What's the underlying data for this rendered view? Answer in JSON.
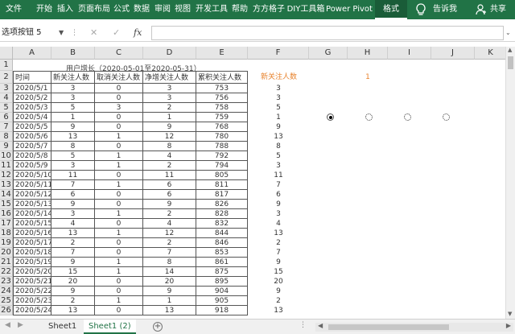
{
  "ribbon": {
    "tabs": [
      "文件",
      "开始",
      "插入",
      "页面布局",
      "公式",
      "数据",
      "审阅",
      "视图",
      "开发工具",
      "帮助",
      "方方格子",
      "DIY工具箱",
      "Power Pivot",
      "格式"
    ],
    "tell_me": "告诉我",
    "share": "共享"
  },
  "formula_bar": {
    "name_box": "选项按钮 5"
  },
  "columns": [
    "A",
    "B",
    "C",
    "D",
    "E",
    "F",
    "G",
    "H",
    "I",
    "J",
    "K"
  ],
  "row_numbers": [
    "1",
    "2",
    "3",
    "4",
    "5",
    "6",
    "7",
    "8",
    "9",
    "10",
    "11",
    "12",
    "13",
    "14",
    "15",
    "16",
    "17",
    "18",
    "19",
    "20",
    "21",
    "22",
    "23",
    "24",
    "25",
    "26"
  ],
  "table_title": "用户增长（2020-05-01至2020-05-31）",
  "table_headers": [
    "时间",
    "新关注人数",
    "取消关注人数",
    "净增关注人数",
    "累积关注人数"
  ],
  "table_rows": [
    [
      "2020/5/1",
      "3",
      "0",
      "3",
      "753"
    ],
    [
      "2020/5/2",
      "3",
      "0",
      "3",
      "756"
    ],
    [
      "2020/5/3",
      "5",
      "3",
      "2",
      "758"
    ],
    [
      "2020/5/4",
      "1",
      "0",
      "1",
      "759"
    ],
    [
      "2020/5/5",
      "9",
      "0",
      "9",
      "768"
    ],
    [
      "2020/5/6",
      "13",
      "1",
      "12",
      "780"
    ],
    [
      "2020/5/7",
      "8",
      "0",
      "8",
      "788"
    ],
    [
      "2020/5/8",
      "5",
      "1",
      "4",
      "792"
    ],
    [
      "2020/5/9",
      "3",
      "1",
      "2",
      "794"
    ],
    [
      "2020/5/10",
      "11",
      "0",
      "11",
      "805"
    ],
    [
      "2020/5/11",
      "7",
      "1",
      "6",
      "811"
    ],
    [
      "2020/5/12",
      "6",
      "0",
      "6",
      "817"
    ],
    [
      "2020/5/13",
      "9",
      "0",
      "9",
      "826"
    ],
    [
      "2020/5/14",
      "3",
      "1",
      "2",
      "828"
    ],
    [
      "2020/5/15",
      "4",
      "0",
      "4",
      "832"
    ],
    [
      "2020/5/16",
      "13",
      "1",
      "12",
      "844"
    ],
    [
      "2020/5/17",
      "2",
      "0",
      "2",
      "846"
    ],
    [
      "2020/5/18",
      "7",
      "0",
      "7",
      "853"
    ],
    [
      "2020/5/19",
      "9",
      "1",
      "8",
      "861"
    ],
    [
      "2020/5/20",
      "15",
      "1",
      "14",
      "875"
    ],
    [
      "2020/5/21",
      "20",
      "0",
      "20",
      "895"
    ],
    [
      "2020/5/22",
      "9",
      "0",
      "9",
      "904"
    ],
    [
      "2020/5/23",
      "2",
      "1",
      "1",
      "905"
    ],
    [
      "2020/5/24",
      "13",
      "0",
      "13",
      "918"
    ]
  ],
  "helper_label": "新关注人数",
  "helper_value": "1",
  "helper_column": [
    "3",
    "3",
    "5",
    "1",
    "9",
    "13",
    "8",
    "5",
    "3",
    "11",
    "7",
    "6",
    "9",
    "3",
    "4",
    "13",
    "2",
    "7",
    "9",
    "15",
    "20",
    "9",
    "2",
    "13"
  ],
  "option_buttons": [
    {
      "selected": true
    },
    {
      "selected": false
    },
    {
      "selected": false
    },
    {
      "selected": false
    }
  ],
  "sheets": [
    "Sheet1",
    "Sheet1 (2)"
  ]
}
